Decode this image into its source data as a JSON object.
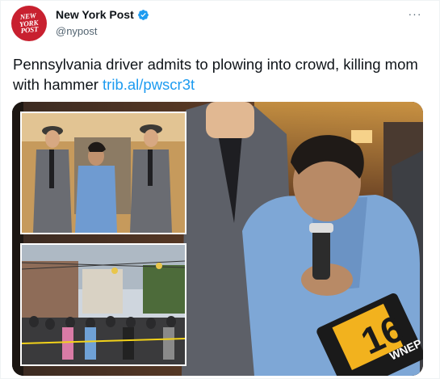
{
  "account": {
    "display_name": "New York Post",
    "handle": "@nypost",
    "logo_text": [
      "NEW",
      "YORK",
      "POST"
    ],
    "verified": true
  },
  "more_label": "···",
  "tweet": {
    "text": "Pennsylvania driver admits to plowing into crowd, killing mom with hammer ",
    "link": "trib.al/pwscr3t"
  },
  "media": {
    "station_badge": "16",
    "station_call": "WNEP"
  },
  "icons": {
    "verified": "verified-badge-icon",
    "more": "more-options-icon"
  },
  "colors": {
    "brand_red": "#c8202f",
    "link_blue": "#1d9bf0",
    "secondary_text": "#536471"
  }
}
